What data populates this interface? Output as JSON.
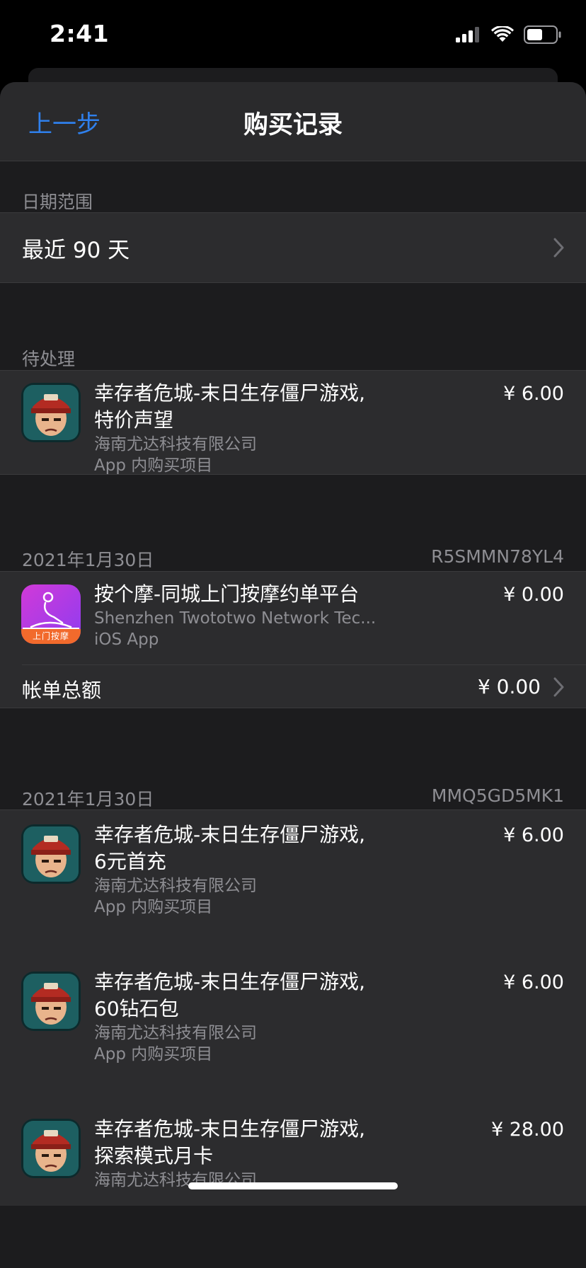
{
  "status_bar": {
    "time": "2:41"
  },
  "nav": {
    "back_label": "上一步",
    "title": "购买记录"
  },
  "date_range": {
    "header": "日期范围",
    "value": "最近 90 天"
  },
  "pending": {
    "header": "待处理",
    "items": [
      {
        "name_line1": "幸存者危城-末日生存僵尸游戏,",
        "name_line2": "特价声望",
        "developer": "海南尤达科技有限公司",
        "type": "App 内购买项目",
        "price": "¥ 6.00",
        "icon": "zombie-game-icon"
      }
    ]
  },
  "orders": [
    {
      "date": "2021年1月30日",
      "order_id": "R5SMMN78YL4",
      "items": [
        {
          "name_line1": "按个摩-同城上门按摩约单平台",
          "developer": "Shenzhen Twototwo Network Tec...",
          "type": "iOS App",
          "price": "¥ 0.00",
          "icon": "massage-app-icon",
          "icon_text": "上门按摩"
        }
      ],
      "total_label": "帐单总额",
      "total_value": "¥ 0.00"
    },
    {
      "date": "2021年1月30日",
      "order_id": "MMQ5GD5MK1",
      "items": [
        {
          "name_line1": "幸存者危城-末日生存僵尸游戏,",
          "name_line2": "6元首充",
          "developer": "海南尤达科技有限公司",
          "type": "App 内购买项目",
          "price": "¥ 6.00",
          "icon": "zombie-game-icon"
        },
        {
          "name_line1": "幸存者危城-末日生存僵尸游戏,",
          "name_line2": "60钻石包",
          "developer": "海南尤达科技有限公司",
          "type": "App 内购买项目",
          "price": "¥ 6.00",
          "icon": "zombie-game-icon"
        },
        {
          "name_line1": "幸存者危城-末日生存僵尸游戏,",
          "name_line2": "探索模式月卡",
          "developer": "海南尤达科技有限公司",
          "price": "¥ 28.00",
          "icon": "zombie-game-icon"
        }
      ]
    }
  ],
  "colors": {
    "accent": "#2f80ed",
    "background": "#1c1c1e",
    "cell": "#2c2c2e",
    "secondary_text": "#8e8e93"
  }
}
